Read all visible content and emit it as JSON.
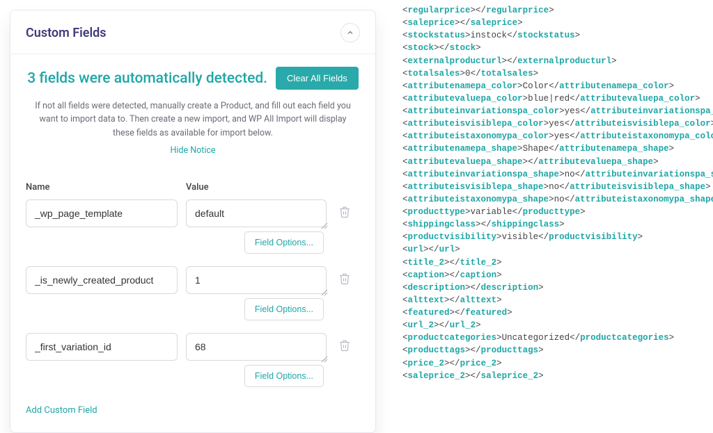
{
  "card": {
    "title": "Custom Fields",
    "detected_text": "3 fields were automatically detected.",
    "clear_label": "Clear All Fields",
    "help_text": "If not all fields were detected, manually create a Product, and fill out each field you want to import data to. Then create a new import, and WP All Import will display these fields as available for import below.",
    "hide_notice_label": "Hide Notice",
    "name_header": "Name",
    "value_header": "Value",
    "field_options_label": "Field Options...",
    "add_field_label": "Add Custom Field"
  },
  "fields": [
    {
      "name": "_wp_page_template",
      "value": "default"
    },
    {
      "name": "_is_newly_created_product",
      "value": "1"
    },
    {
      "name": "_first_variation_id",
      "value": "68"
    }
  ],
  "xml": [
    {
      "tag": "regularprice",
      "text": ""
    },
    {
      "tag": "saleprice",
      "text": ""
    },
    {
      "tag": "stockstatus",
      "text": "instock"
    },
    {
      "tag": "stock",
      "text": ""
    },
    {
      "tag": "externalproducturl",
      "text": ""
    },
    {
      "tag": "totalsales",
      "text": "0"
    },
    {
      "tag": "attributenamepa_color",
      "text": "Color"
    },
    {
      "tag": "attributevaluepa_color",
      "text": "blue|red"
    },
    {
      "tag": "attributeinvariationspa_color",
      "text": "yes"
    },
    {
      "tag": "attributeisvisiblepa_color",
      "text": "yes"
    },
    {
      "tag": "attributeistaxonomypa_color",
      "text": "yes"
    },
    {
      "tag": "attributenamepa_shape",
      "text": "Shape"
    },
    {
      "tag": "attributevaluepa_shape",
      "text": ""
    },
    {
      "tag": "attributeinvariationspa_shape",
      "text": "no"
    },
    {
      "tag": "attributeisvisiblepa_shape",
      "text": "no"
    },
    {
      "tag": "attributeistaxonomypa_shape",
      "text": "no"
    },
    {
      "tag": "producttype",
      "text": "variable"
    },
    {
      "tag": "shippingclass",
      "text": ""
    },
    {
      "tag": "productvisibility",
      "text": "visible"
    },
    {
      "tag": "url",
      "text": ""
    },
    {
      "tag": "title_2",
      "text": ""
    },
    {
      "tag": "caption",
      "text": ""
    },
    {
      "tag": "description",
      "text": ""
    },
    {
      "tag": "alttext",
      "text": ""
    },
    {
      "tag": "featured",
      "text": ""
    },
    {
      "tag": "url_2",
      "text": ""
    },
    {
      "tag": "productcategories",
      "text": "Uncategorized"
    },
    {
      "tag": "producttags",
      "text": ""
    },
    {
      "tag": "price_2",
      "text": ""
    },
    {
      "tag": "saleprice_2",
      "text": ""
    }
  ]
}
